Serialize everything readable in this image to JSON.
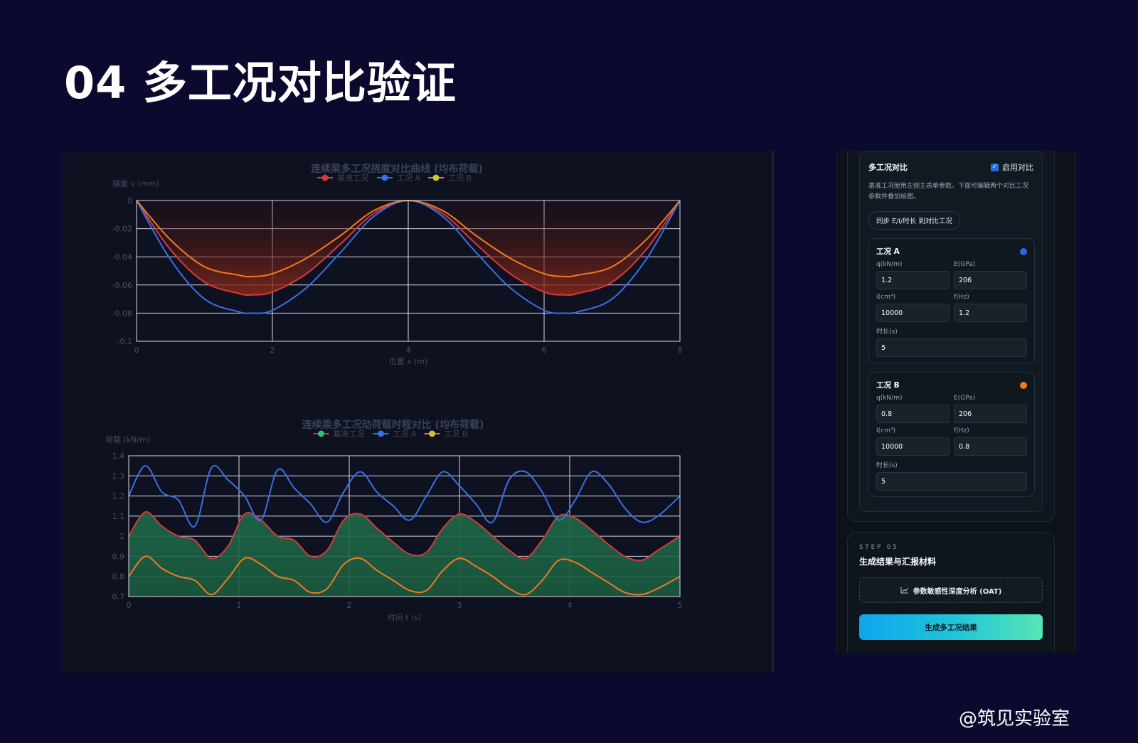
{
  "slide": {
    "title": "04 多工况对比验证",
    "watermark": "@筑见实验室"
  },
  "colors": {
    "background": "#0b0a2e",
    "baseline_red": "#d83a3a",
    "case_a_blue": "#3b6fe6",
    "case_b_orange": "#f07a20",
    "baseline_green_marker": "#2fc46b",
    "case_b_marker_yellow": "#c9c930",
    "accent_gradient_start": "#0ea5f0",
    "accent_gradient_end": "#59e6b4"
  },
  "chart_data": [
    {
      "type": "line",
      "title": "连续梁多工况挠度对比曲线 (均布荷载)",
      "xlabel": "位置 x (m)",
      "ylabel": "挠度 v (mm)",
      "xlim": [
        0,
        8
      ],
      "ylim": [
        -0.1,
        0
      ],
      "xticks": [
        "0",
        "2",
        "4",
        "6",
        "8"
      ],
      "yticks": [
        "0",
        "-0.02",
        "-0.04",
        "-0.06",
        "-0.08",
        "-0.1"
      ],
      "grid": true,
      "legend_position": "top-center",
      "series": [
        {
          "name": "基准工况",
          "marker_color": "#d83a3a",
          "color": "#d83a3a",
          "fill": true,
          "x": [
            0,
            0.5,
            1,
            1.5,
            1.7,
            2,
            2.5,
            3,
            3.5,
            4,
            4.5,
            5,
            5.5,
            6,
            6.3,
            6.5,
            7,
            7.5,
            8
          ],
          "y": [
            0,
            -0.035,
            -0.058,
            -0.066,
            -0.067,
            -0.065,
            -0.052,
            -0.031,
            -0.009,
            0,
            -0.009,
            -0.031,
            -0.052,
            -0.065,
            -0.067,
            -0.066,
            -0.058,
            -0.035,
            0
          ]
        },
        {
          "name": "工况 A",
          "marker_color": "#3b6fe6",
          "color": "#3b6fe6",
          "fill": false,
          "x": [
            0,
            0.5,
            1,
            1.5,
            1.7,
            2,
            2.5,
            3,
            3.5,
            4,
            4.5,
            5,
            5.5,
            6,
            6.3,
            6.5,
            7,
            7.5,
            8
          ],
          "y": [
            0,
            -0.042,
            -0.07,
            -0.079,
            -0.08,
            -0.078,
            -0.062,
            -0.037,
            -0.011,
            0,
            -0.011,
            -0.037,
            -0.062,
            -0.078,
            -0.08,
            -0.079,
            -0.07,
            -0.042,
            0
          ]
        },
        {
          "name": "工况 B",
          "marker_color": "#c9c930",
          "color": "#f07a20",
          "fill": false,
          "x": [
            0,
            0.5,
            1,
            1.5,
            1.7,
            2,
            2.5,
            3,
            3.5,
            4,
            4.5,
            5,
            5.5,
            6,
            6.3,
            6.5,
            7,
            7.5,
            8
          ],
          "y": [
            0,
            -0.028,
            -0.047,
            -0.053,
            -0.054,
            -0.052,
            -0.041,
            -0.025,
            -0.007,
            0,
            -0.007,
            -0.025,
            -0.041,
            -0.052,
            -0.054,
            -0.053,
            -0.047,
            -0.028,
            0
          ]
        }
      ]
    },
    {
      "type": "line",
      "title": "连续梁多工况动荷载时程对比 (均布荷载)",
      "xlabel": "时间 t (s)",
      "ylabel": "荷载 (kN/m)",
      "xlim": [
        0,
        5
      ],
      "ylim": [
        0.7,
        1.4
      ],
      "xticks": [
        "0",
        "1",
        "2",
        "3",
        "4",
        "5"
      ],
      "yticks": [
        "1.4",
        "1.3",
        "1.2",
        "1.1",
        "1",
        "0.9",
        "0.8",
        "0.7"
      ],
      "grid": true,
      "legend_position": "top-center",
      "series": [
        {
          "name": "基准工况",
          "marker_color": "#2fc46b",
          "color": "#d83a3a",
          "fill": true,
          "x": [
            0,
            0.15,
            0.3,
            0.45,
            0.6,
            0.75,
            0.9,
            1.05,
            1.2,
            1.35,
            1.5,
            1.65,
            1.8,
            1.95,
            2.1,
            2.25,
            2.4,
            2.55,
            2.7,
            2.85,
            3.0,
            3.15,
            3.3,
            3.45,
            3.6,
            3.75,
            3.9,
            4.05,
            4.2,
            4.35,
            4.5,
            4.65,
            4.8,
            5.0
          ],
          "y": [
            1.0,
            1.12,
            1.05,
            1.0,
            0.98,
            0.89,
            0.95,
            1.11,
            1.08,
            1.0,
            0.98,
            0.9,
            0.93,
            1.08,
            1.11,
            1.04,
            0.97,
            0.91,
            0.92,
            1.04,
            1.11,
            1.07,
            1.0,
            0.93,
            0.89,
            0.98,
            1.1,
            1.09,
            1.03,
            0.96,
            0.9,
            0.88,
            0.93,
            1.0
          ]
        },
        {
          "name": "工况 A",
          "marker_color": "#3b6fe6",
          "color": "#3b6fe6",
          "fill": false,
          "x": [
            0,
            0.15,
            0.3,
            0.45,
            0.6,
            0.75,
            0.9,
            1.05,
            1.2,
            1.35,
            1.5,
            1.65,
            1.8,
            1.95,
            2.1,
            2.25,
            2.4,
            2.55,
            2.7,
            2.85,
            3.0,
            3.15,
            3.3,
            3.45,
            3.6,
            3.75,
            3.9,
            4.05,
            4.2,
            4.35,
            4.5,
            4.65,
            4.8,
            5.0
          ],
          "y": [
            1.2,
            1.35,
            1.22,
            1.18,
            1.05,
            1.34,
            1.28,
            1.2,
            1.08,
            1.33,
            1.24,
            1.16,
            1.07,
            1.22,
            1.32,
            1.22,
            1.15,
            1.08,
            1.2,
            1.32,
            1.25,
            1.16,
            1.07,
            1.28,
            1.32,
            1.22,
            1.08,
            1.18,
            1.32,
            1.26,
            1.14,
            1.07,
            1.1,
            1.2
          ]
        },
        {
          "name": "工况 B",
          "marker_color": "#c9c930",
          "color": "#f07a20",
          "fill": false,
          "x": [
            0,
            0.15,
            0.3,
            0.45,
            0.6,
            0.75,
            0.9,
            1.05,
            1.2,
            1.35,
            1.5,
            1.65,
            1.8,
            1.95,
            2.1,
            2.25,
            2.4,
            2.55,
            2.7,
            2.85,
            3.0,
            3.15,
            3.3,
            3.45,
            3.6,
            3.75,
            3.9,
            4.05,
            4.2,
            4.35,
            4.5,
            4.65,
            4.8,
            5.0
          ],
          "y": [
            0.8,
            0.9,
            0.84,
            0.8,
            0.78,
            0.71,
            0.79,
            0.89,
            0.86,
            0.8,
            0.78,
            0.72,
            0.74,
            0.86,
            0.89,
            0.83,
            0.78,
            0.73,
            0.73,
            0.83,
            0.89,
            0.85,
            0.8,
            0.74,
            0.71,
            0.78,
            0.88,
            0.87,
            0.82,
            0.77,
            0.72,
            0.71,
            0.74,
            0.8
          ]
        }
      ]
    }
  ],
  "side_panel": {
    "compare": {
      "title": "多工况对比",
      "enable_label": "启用对比",
      "enable_checked": true,
      "description": "基准工况使用左侧主表单参数。下面可编辑两个对比工况参数并叠加绘图。",
      "sync_button": "同步 E/I/时长 到对比工况",
      "cases": [
        {
          "title": "工况 A",
          "dot_color": "#2f66e8",
          "q_label": "q(kN/m)",
          "q_value": "1.2",
          "e_label": "E(GPa)",
          "e_value": "206",
          "i_label": "I(cm⁴)",
          "i_value": "10000",
          "f_label": "f(Hz)",
          "f_value": "1.2",
          "t_label": "时长(s)",
          "t_value": "5"
        },
        {
          "title": "工况 B",
          "dot_color": "#f07a20",
          "q_label": "q(kN/m)",
          "q_value": "0.8",
          "e_label": "E(GPa)",
          "e_value": "206",
          "i_label": "I(cm⁴)",
          "i_value": "10000",
          "f_label": "f(Hz)",
          "f_value": "0.8",
          "t_label": "时长(s)",
          "t_value": "5"
        }
      ]
    },
    "step": {
      "label": "STEP 05",
      "title": "生成结果与汇报材料",
      "oat_button": "参数敏感性深度分析 (OAT)",
      "generate_button": "生成多工况结果"
    }
  }
}
